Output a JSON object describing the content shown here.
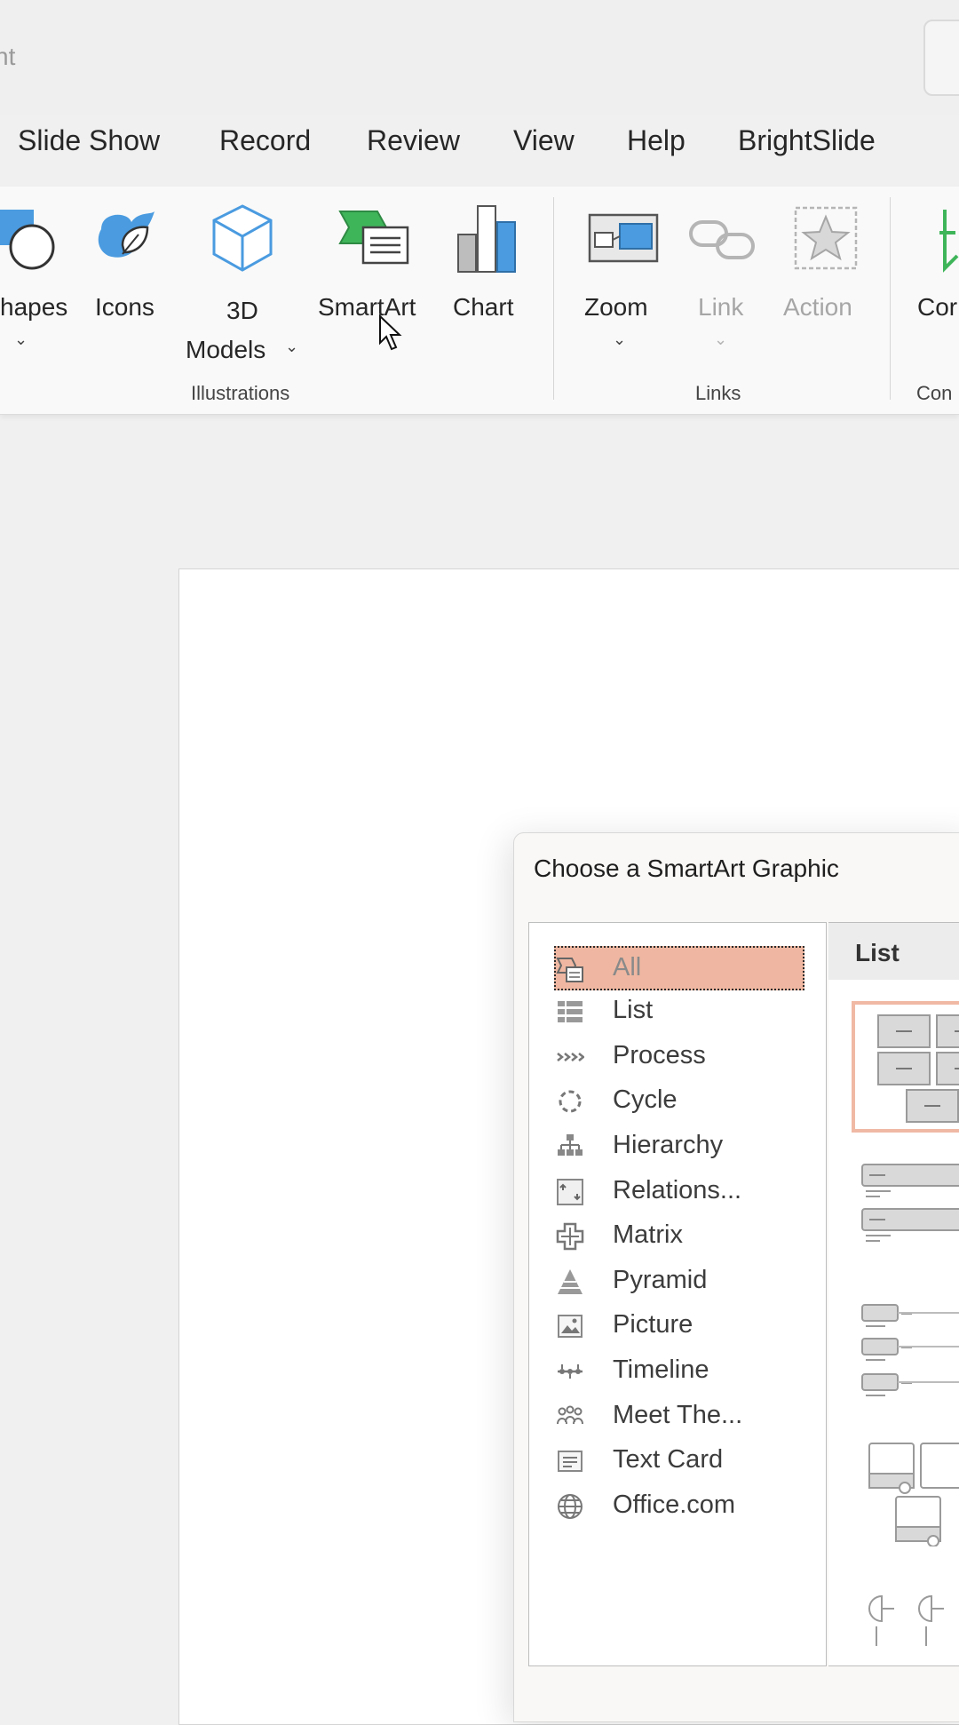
{
  "window": {
    "title_fragment": "nt"
  },
  "tabs": [
    {
      "label": "Slide Show"
    },
    {
      "label": "Record"
    },
    {
      "label": "Review"
    },
    {
      "label": "View"
    },
    {
      "label": "Help"
    },
    {
      "label": "BrightSlide"
    }
  ],
  "ribbon": {
    "illustrations": {
      "shapes_label": "hapes",
      "icons_label": "Icons",
      "models_label_1": "3D",
      "models_label_2": "Models",
      "smartart_label": "SmartArt",
      "chart_label": "Chart",
      "group_label": "Illustrations"
    },
    "links": {
      "zoom_label": "Zoom",
      "link_label": "Link",
      "action_label": "Action",
      "group_label": "Links"
    },
    "comments": {
      "button_label": "Cor",
      "group_label": "Con"
    }
  },
  "dialog": {
    "title": "Choose a SmartArt Graphic",
    "categories": [
      {
        "label": "All",
        "icon": "all-icon",
        "selected": true
      },
      {
        "label": "List",
        "icon": "list-icon"
      },
      {
        "label": "Process",
        "icon": "process-icon"
      },
      {
        "label": "Cycle",
        "icon": "cycle-icon"
      },
      {
        "label": "Hierarchy",
        "icon": "hierarchy-icon"
      },
      {
        "label": "Relations...",
        "icon": "relationship-icon"
      },
      {
        "label": "Matrix",
        "icon": "matrix-icon"
      },
      {
        "label": "Pyramid",
        "icon": "pyramid-icon"
      },
      {
        "label": "Picture",
        "icon": "picture-icon"
      },
      {
        "label": "Timeline",
        "icon": "timeline-icon"
      },
      {
        "label": "Meet The...",
        "icon": "meet-the-team-icon"
      },
      {
        "label": "Text Card",
        "icon": "text-card-icon"
      },
      {
        "label": "Office.com",
        "icon": "globe-icon"
      }
    ],
    "layout_header": "List"
  },
  "colors": {
    "selection_fill": "#efb7a1",
    "accent_blue": "#4a9be0",
    "accent_green": "#3fb55a"
  }
}
